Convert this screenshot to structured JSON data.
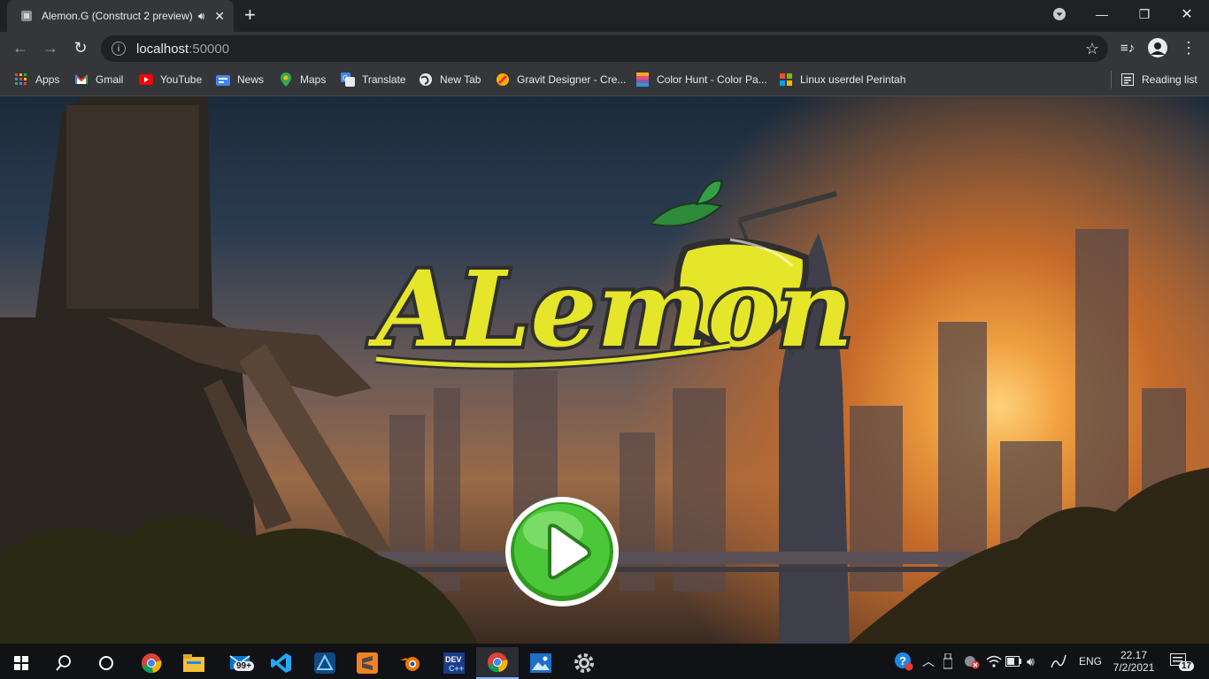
{
  "browser": {
    "tab": {
      "title": "Alemon.G (Construct 2 preview)",
      "audio_icon": "speaker-icon",
      "close_icon": "close-icon"
    },
    "new_tab_icon": "plus-icon",
    "window_controls": [
      "profile-dropdown-icon",
      "minimize-icon",
      "restore-icon",
      "close-icon"
    ],
    "address": {
      "host": "localhost",
      "port": ":50000"
    },
    "bookmarks": [
      {
        "label": "Apps",
        "icon": "apps-grid-icon"
      },
      {
        "label": "Gmail",
        "icon": "gmail-icon"
      },
      {
        "label": "YouTube",
        "icon": "youtube-icon"
      },
      {
        "label": "News",
        "icon": "news-icon"
      },
      {
        "label": "Maps",
        "icon": "maps-icon"
      },
      {
        "label": "Translate",
        "icon": "translate-icon"
      },
      {
        "label": "New Tab",
        "icon": "globe-icon"
      },
      {
        "label": "Gravit Designer - Cre...",
        "icon": "gravit-icon"
      },
      {
        "label": "Color Hunt - Color Pa...",
        "icon": "colorhunt-icon"
      },
      {
        "label": "Linux userdel Perintah",
        "icon": "windows-tiles-icon"
      }
    ],
    "reading_list": "Reading list"
  },
  "game": {
    "logo_text": "ALemon",
    "play_icon": "play-icon"
  },
  "taskbar": {
    "badge": "99+",
    "lang": "ENG",
    "time": "22.17",
    "date": "7/2/2021",
    "notifications": "17"
  },
  "colors": {
    "chrome_dark": "#202124",
    "chrome_bar": "#35363a",
    "lemon": "#e5e52a",
    "play_green": "#3dbf2a"
  }
}
